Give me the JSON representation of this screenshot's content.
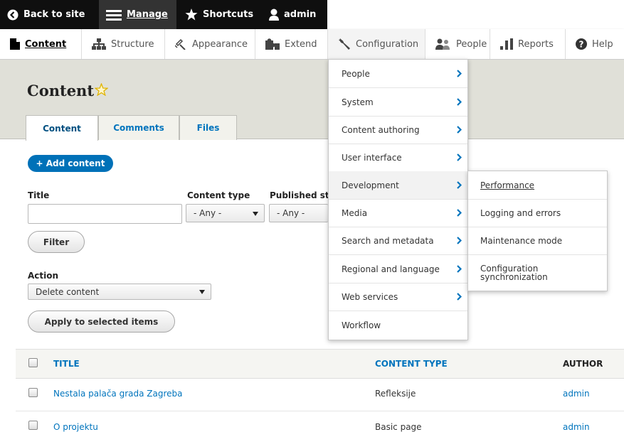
{
  "toolbar": {
    "back": "Back to site",
    "manage": "Manage",
    "shortcuts": "Shortcuts",
    "user": "admin"
  },
  "tray": {
    "items": [
      {
        "label": "Content",
        "icon": "file-icon"
      },
      {
        "label": "Structure",
        "icon": "sitemap-icon"
      },
      {
        "label": "Appearance",
        "icon": "brush-icon"
      },
      {
        "label": "Extend",
        "icon": "puzzle-icon"
      },
      {
        "label": "Configuration",
        "icon": "wrench-icon"
      },
      {
        "label": "People",
        "icon": "people-icon"
      },
      {
        "label": "Reports",
        "icon": "bar-chart-icon"
      },
      {
        "label": "Help",
        "icon": "help-icon"
      }
    ]
  },
  "page": {
    "title": "Content",
    "tabs": [
      "Content",
      "Comments",
      "Files"
    ]
  },
  "actions": {
    "add_content": "+ Add content"
  },
  "filters": {
    "title_label": "Title",
    "title_value": "",
    "content_type_label": "Content type",
    "content_type_value": "- Any -",
    "published_label": "Published sta",
    "published_value": "- Any -",
    "filter_button": "Filter"
  },
  "bulk": {
    "action_label": "Action",
    "action_value": "Delete content",
    "apply_button": "Apply to selected items"
  },
  "table": {
    "headers": [
      "TITLE",
      "CONTENT TYPE",
      "AUTHOR"
    ],
    "rows": [
      {
        "title": "Nestala palača grada Zagreba",
        "type": "Refleksije",
        "author": "admin"
      },
      {
        "title": "O projektu",
        "type": "Basic page",
        "author": "admin"
      }
    ]
  },
  "config_menu": {
    "items": [
      "People",
      "System",
      "Content authoring",
      "User interface",
      "Development",
      "Media",
      "Search and metadata",
      "Regional and language",
      "Web services",
      "Workflow"
    ]
  },
  "development_menu": {
    "items": [
      "Performance",
      "Logging and errors",
      "Maintenance mode",
      "Configuration synchronization"
    ]
  },
  "colors": {
    "link": "#0074bd",
    "primary_button": "#0071b8",
    "toolbar_bg": "#0f0f0f"
  }
}
